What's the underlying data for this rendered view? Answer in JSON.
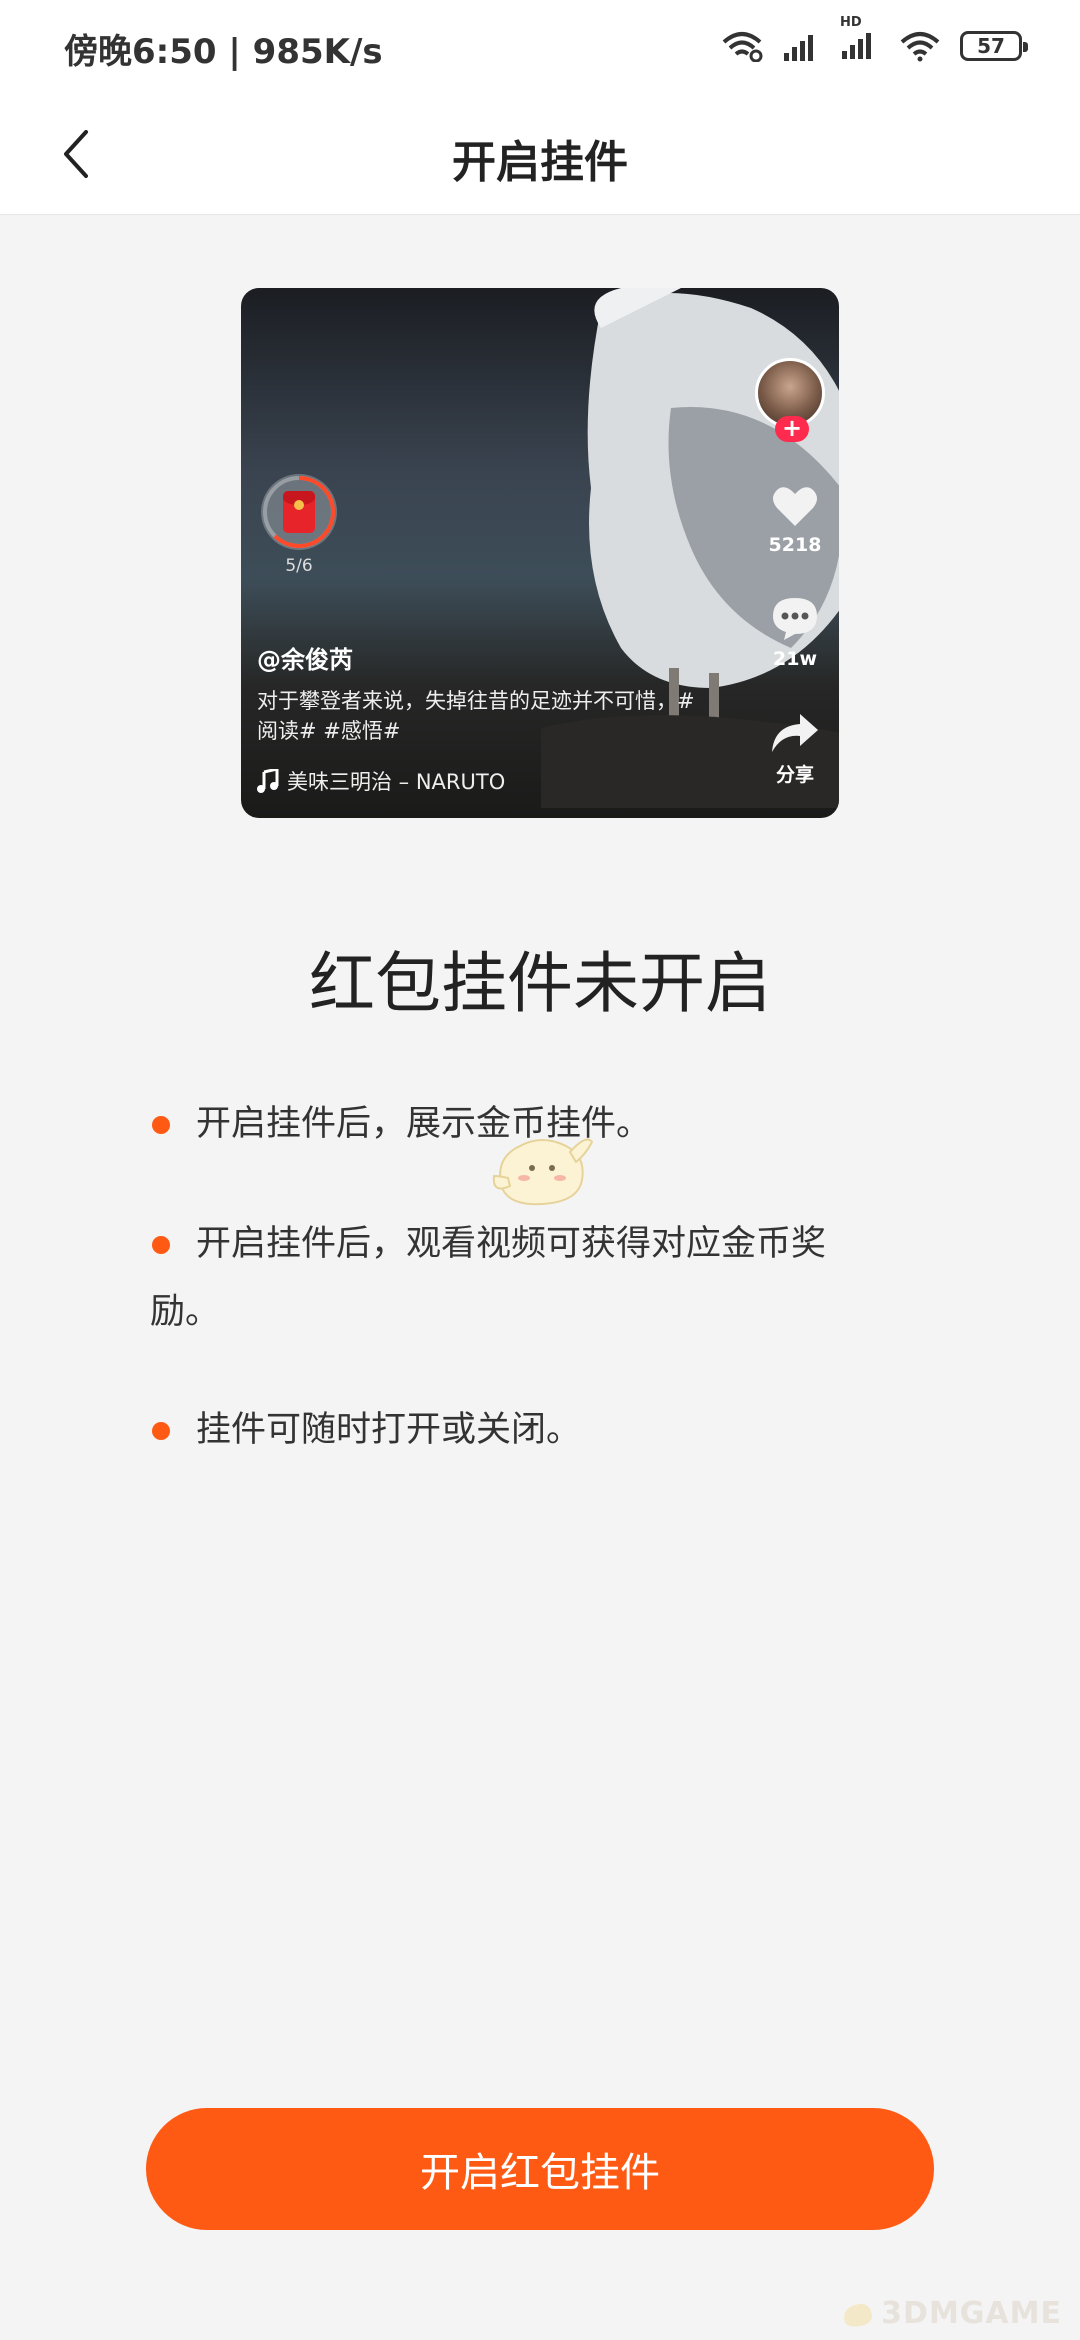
{
  "status_bar": {
    "time": "傍晚6:50 | 985K/s",
    "hd_label": "HD",
    "battery": "57"
  },
  "nav": {
    "title": "开启挂件"
  },
  "preview": {
    "author": "@余俊芮",
    "caption": "对于攀登者来说，失掉往昔的足迹并不可惜，#阅读# #感悟#",
    "music": "美味三明治 – NARUTO",
    "redpack_count": "5/6",
    "follow_symbol": "+",
    "likes": "5218",
    "comments": "21w",
    "share": "分享"
  },
  "headline": "红包挂件未开启",
  "bullets": [
    "开启挂件后，展示金币挂件。",
    "开启挂件后，观看视频可获得对应金币奖励。",
    "挂件可随时打开或关闭。"
  ],
  "cta": {
    "label": "开启红包挂件"
  },
  "watermark": "3DMGAME",
  "colors": {
    "accent": "#ff5a14",
    "background": "#f4f4f4"
  }
}
